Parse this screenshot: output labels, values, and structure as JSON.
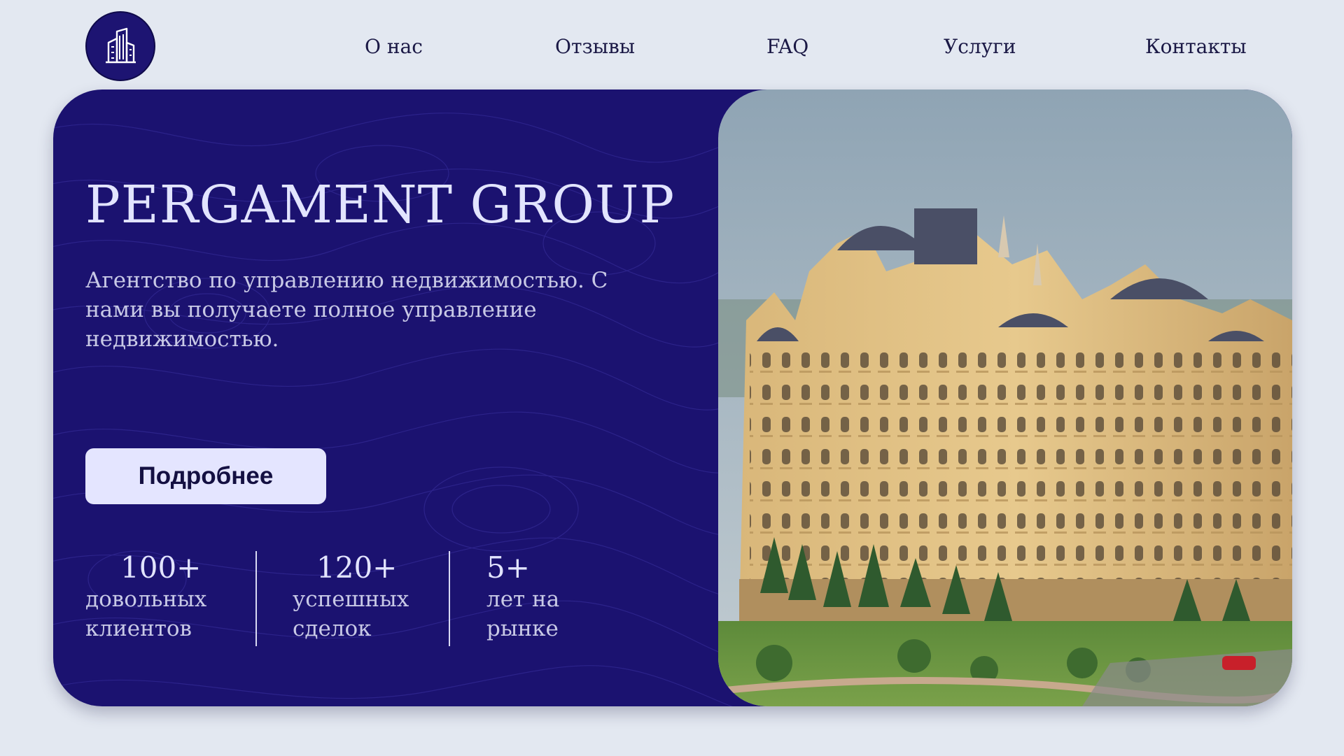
{
  "colors": {
    "page_bg": "#e3e8f1",
    "hero_bg": "#1b1270",
    "logo_bg": "#1d1472",
    "accent_light": "#e4e5ff",
    "text_dark": "#1a1845"
  },
  "header": {
    "logo_icon": "building-icon",
    "nav": [
      {
        "label": "О нас"
      },
      {
        "label": "Отзывы"
      },
      {
        "label": "FAQ"
      },
      {
        "label": "Услуги"
      },
      {
        "label": "Контакты"
      }
    ]
  },
  "hero": {
    "title": "PERGAMENT GROUP",
    "description": "Агентство по управлению недвижимостью. С нами вы получаете полное управление недвижимостью.",
    "cta_label": "Подробнее",
    "image_icon": "building-photo",
    "stats": [
      {
        "value": "100+",
        "label": "довольных клиентов"
      },
      {
        "value": "120+",
        "label": "успешных сделок"
      },
      {
        "value": "5+",
        "label": "лет на рынке"
      }
    ]
  }
}
